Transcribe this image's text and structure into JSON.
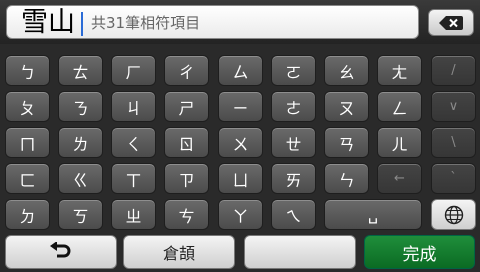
{
  "input": {
    "text": "雪山",
    "hint": "共31筆相符項目"
  },
  "keys": {
    "r1": [
      "ㄅ",
      "ㄊ",
      "ㄏ",
      "ㄔ",
      "ㄙ",
      "ㄛ",
      "ㄠ",
      "ㄤ",
      "/"
    ],
    "r2": [
      "ㄆ",
      "ㄋ",
      "ㄐ",
      "ㄕ",
      "ㄧ",
      "ㄜ",
      "ㄡ",
      "ㄥ",
      "∨"
    ],
    "r3": [
      "ㄇ",
      "ㄌ",
      "ㄑ",
      "ㄖ",
      "ㄨ",
      "ㄝ",
      "ㄢ",
      "ㄦ",
      "\\"
    ],
    "r4": [
      "ㄈ",
      "ㄍ",
      "ㄒ",
      "ㄗ",
      "ㄩ",
      "ㄞ",
      "ㄣ",
      "←",
      "ˋ"
    ],
    "r5": [
      "ㄉ",
      "ㄎ",
      "ㄓ",
      "ㄘ",
      "ㄚ",
      "ㄟ",
      "␣"
    ]
  },
  "icons": {
    "backspace": "backspace-icon",
    "globe": "globe-icon",
    "back": "back-arrow-icon"
  },
  "bottom": {
    "back_label": "",
    "cangjie_label": "倉頡",
    "blank_label": "",
    "done_label": "完成"
  },
  "colors": {
    "done": "#0f7a2b",
    "caret": "#2a6bd6"
  }
}
